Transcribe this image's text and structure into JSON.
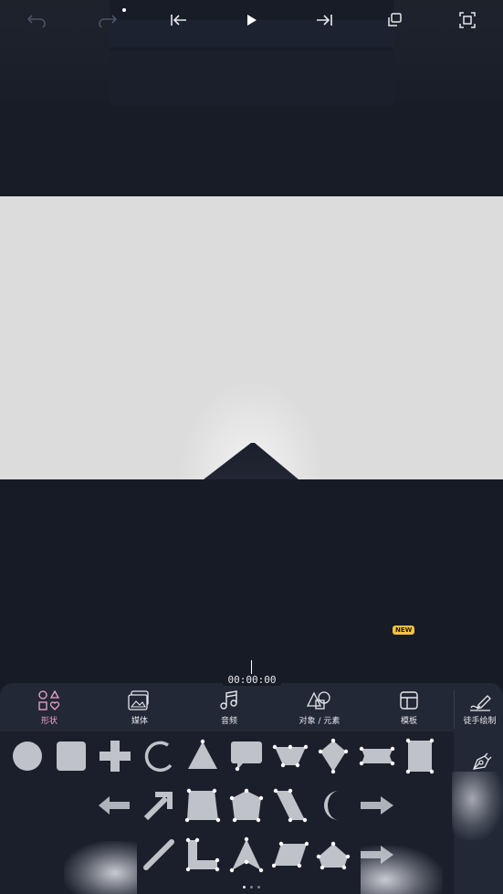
{
  "playback": {
    "undo_icon": "undo-arrow-icon",
    "redo_icon": "redo-arrow-icon",
    "skip_start_icon": "skip-to-start-icon",
    "play_icon": "play-icon",
    "skip_end_icon": "skip-to-end-icon",
    "layers_icon": "layers-icon",
    "new_badge": "NEW",
    "fullscreen_icon": "fullscreen-icon",
    "timecode": "00:00:00"
  },
  "tabs": [
    {
      "id": "shapes",
      "label": "形状",
      "icon": "shapes-icon",
      "active": true
    },
    {
      "id": "media",
      "label": "媒体",
      "icon": "media-icon",
      "active": false
    },
    {
      "id": "audio",
      "label": "音频",
      "icon": "music-note-icon",
      "active": false
    },
    {
      "id": "objects",
      "label": "对象 / 元素",
      "icon": "objects-icon",
      "active": false
    },
    {
      "id": "templates",
      "label": "模板",
      "icon": "template-icon",
      "active": false
    }
  ],
  "side_tools": [
    {
      "id": "freehand",
      "label": "徒手绘制",
      "icon": "freehand-pen-icon"
    },
    {
      "id": "pen",
      "label": "",
      "icon": "pen-tool-icon"
    }
  ],
  "shapes": [
    "circle",
    "square",
    "plus",
    "arc",
    "triangle",
    "speech-bubble",
    "diamond-pentagon",
    "kite",
    "rectangle-pointed",
    "rectangle-tall",
    "arrow-left",
    "arrow-diagonal",
    "trapezoid",
    "house-pentagon",
    "parallelogram",
    "crescent",
    "arrow-right",
    "line",
    "l-shape",
    "arrow-head",
    "parallelogram-2",
    "pentagon",
    "arrow-right-2"
  ],
  "colors": {
    "background": "#171b26",
    "canvas": "#dcdcdc",
    "panel": "#232836",
    "accent": "#f0a6c9",
    "badge": "#f5c242"
  }
}
